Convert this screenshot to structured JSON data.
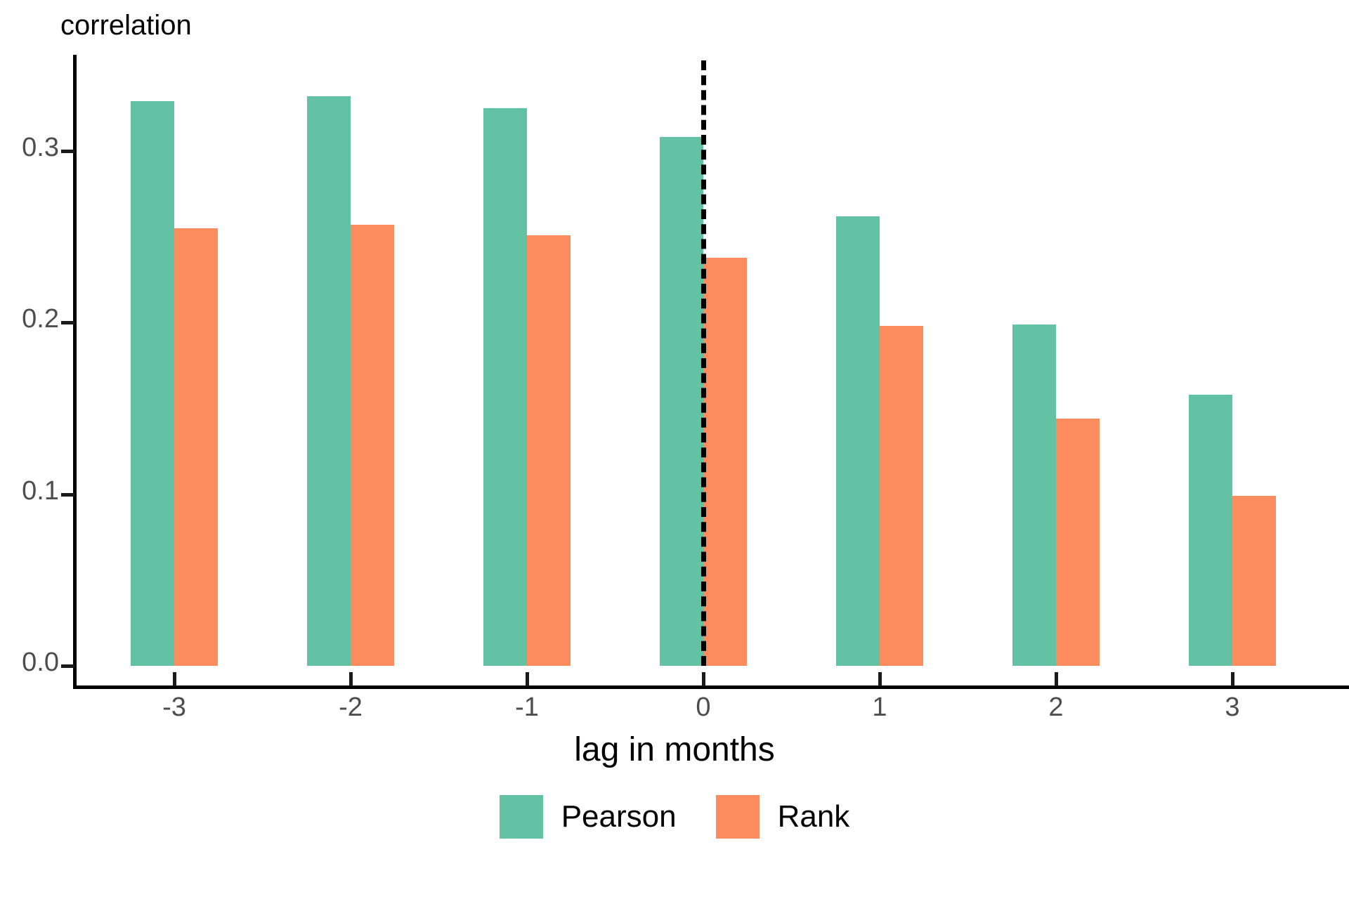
{
  "chart_data": {
    "type": "bar",
    "title": "",
    "subtitle": "",
    "ylabel": "correlation",
    "xlabel": "lag in months",
    "categories": [
      "-3",
      "-2",
      "-1",
      "0",
      "1",
      "2",
      "3"
    ],
    "x_tick_labels": [
      "-3",
      "-2",
      "-1",
      "0",
      "1",
      "2",
      "3"
    ],
    "y_tick_labels": [
      "0.0",
      "0.1",
      "0.2",
      "0.3"
    ],
    "y_ticks": [
      0.0,
      0.1,
      0.2,
      0.3
    ],
    "ylim": [
      0.0,
      0.345
    ],
    "xlim": [
      -3.5,
      3.65
    ],
    "grid": false,
    "legend_position": "bottom",
    "series": [
      {
        "name": "Pearson",
        "color": "#62c2a3",
        "values": [
          0.329,
          0.332,
          0.325,
          0.308,
          0.262,
          0.199,
          0.158
        ]
      },
      {
        "name": "Rank",
        "color": "#fa8c5e",
        "values": [
          0.255,
          0.257,
          0.251,
          0.238,
          0.198,
          0.144,
          0.099
        ]
      }
    ],
    "annotations": [
      {
        "type": "vertical-dashed-line",
        "x": 0,
        "color": "#000000",
        "y_from": 0.0,
        "y_to": 0.353
      }
    ]
  },
  "legend": {
    "entries": [
      {
        "label": "Pearson",
        "color": "#62c2a3"
      },
      {
        "label": "Rank",
        "color": "#fa8c5e"
      }
    ]
  },
  "colors": {
    "pearson": "#62c2a3",
    "rank": "#fa8c5e",
    "axis": "#000000",
    "tick_label": "#4d4d4d",
    "background": "#ffffff"
  }
}
